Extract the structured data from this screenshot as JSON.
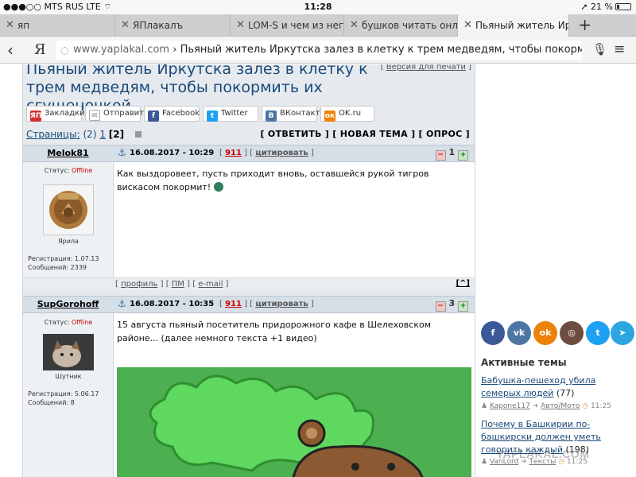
{
  "status_bar": {
    "carrier": "MTS RUS",
    "network": "LTE",
    "time": "11:28",
    "battery": "21 %",
    "battery_level": 0.21
  },
  "tabs": [
    {
      "label": "яп",
      "active": false
    },
    {
      "label": "ЯПлакалъ",
      "active": false
    },
    {
      "label": "LOM-S и чем из него с",
      "active": false
    },
    {
      "label": "бушков читать онлайн",
      "active": false
    },
    {
      "label": "Пьяный житель Иркутск",
      "active": true
    }
  ],
  "address_bar": {
    "browser_letter": "Я",
    "domain": "www.yaplakal.com",
    "page_title": "Пьяный житель Иркутска залез в клетку к трем медведям, чтобы покормить их сгуще"
  },
  "topic": {
    "title": "Пьяный житель Иркутска залез в клетку к трем медведям, чтобы покормить их сгущеночкой",
    "print_label": "Версия для печати"
  },
  "share_buttons": [
    {
      "label": "Закладки",
      "icon": "ЯП",
      "color": "#d32f2f"
    },
    {
      "label": "Отправить",
      "icon": "✉",
      "color": "#888888"
    },
    {
      "label": "Facebook",
      "icon": "f",
      "color": "#3b5998"
    },
    {
      "label": "Twitter",
      "icon": "t",
      "color": "#1da1f2"
    },
    {
      "label": "ВКонтакте",
      "icon": "В",
      "color": "#4c75a3"
    },
    {
      "label": "OK.ru",
      "icon": "ок",
      "color": "#ee8208"
    }
  ],
  "pagination": {
    "label": "Страницы:",
    "total": "(2)",
    "page1": "1",
    "current": "[2]"
  },
  "topic_actions": "[ ОТВЕТИТЬ ] [ НОВАЯ ТЕМА ] [ ОПРОС ]",
  "posts": [
    {
      "username": "Melok81",
      "date": "16.08.2017 - 10:29",
      "post_number": "911",
      "quote": "цитировать",
      "rating": "1",
      "status_label": "Статус:",
      "status": "Offline",
      "rank": "Ярила",
      "registration": "Регистрация: 1.07.13",
      "messages": "Сообщений: 2339",
      "text": "Как выздоровеет, пусть приходит вновь, оставшейся рукой тигров вискасом покормит!",
      "footer_profile": "профиль",
      "footer_pm": "ПМ",
      "footer_email": "e-mail",
      "footer_up": "[^]"
    },
    {
      "username": "SupGorohoff",
      "date": "16.08.2017 - 10:35",
      "post_number": "911",
      "quote": "цитировать",
      "rating": "3",
      "status_label": "Статус:",
      "status": "Offline",
      "rank": "Шутник",
      "registration": "Регистрация: 5.06.17",
      "messages": "Сообщений: 8",
      "text": "15 августа пьяный посетитель придорожного кафе в Шелеховском районе... (далее немного текста +1 видео)"
    }
  ],
  "social_icons": [
    {
      "name": "facebook",
      "glyph": "f",
      "color": "#3b5998"
    },
    {
      "name": "vk",
      "glyph": "vk",
      "color": "#4c75a3"
    },
    {
      "name": "odnoklassniki",
      "glyph": "ok",
      "color": "#ee8208"
    },
    {
      "name": "instagram",
      "glyph": "◎",
      "color": "#6d4c41"
    },
    {
      "name": "twitter",
      "glyph": "t",
      "color": "#1da1f2"
    },
    {
      "name": "telegram",
      "glyph": "➤",
      "color": "#2ca5e0"
    }
  ],
  "active_topics": {
    "heading": "Активные темы",
    "items": [
      {
        "title": "Бабушка-пешеход убила семерых людей",
        "count": "(77)",
        "user": "Kapone117",
        "section": "Авто/Мото",
        "time": "11:25"
      },
      {
        "title": "Почему в Башкирии по-башкирски должен уметь говорить каждый",
        "count": "(198)",
        "user": "VanLord",
        "section": "Тексты",
        "time": "11:25"
      }
    ]
  },
  "watermark": "YAPLAKAL.COM",
  "colors": {
    "link": "#1a4a7a",
    "post_number": "#cc0000",
    "offline": "#cc0000",
    "header_bg": "#d6dee6",
    "image_bg": "#4caf50"
  }
}
